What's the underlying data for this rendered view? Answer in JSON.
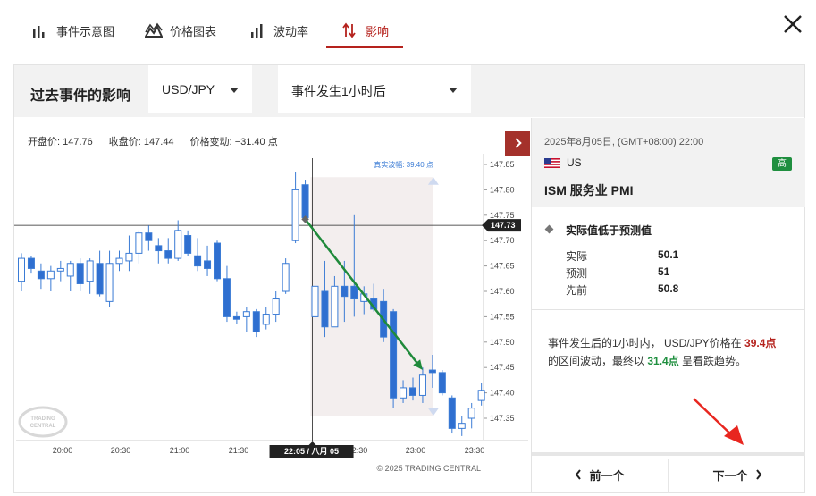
{
  "tabs": [
    {
      "label": "事件示意图",
      "icon": "bar-chart-icon"
    },
    {
      "label": "价格图表",
      "icon": "mountain-chart-icon"
    },
    {
      "label": "波动率",
      "icon": "volatility-bars-icon"
    },
    {
      "label": "影响",
      "icon": "up-down-arrows-icon",
      "active": true
    }
  ],
  "toolbar": {
    "title": "过去事件的影响",
    "pair_select": "USD/JPY",
    "time_select": "事件发生1小时后"
  },
  "stats": {
    "open_label": "开盘价:",
    "open": "147.76",
    "close_label": "收盘价:",
    "close": "147.44",
    "change_label": "价格变动:",
    "change": "−31.40 点"
  },
  "chart_data": {
    "type": "candlestick",
    "x_ticks": [
      "20:00",
      "20:30",
      "21:00",
      "21:30",
      "22:30",
      "23:00",
      "23:30"
    ],
    "crosshair_x_label": "22:05 / 八月 05",
    "y_ticks": [
      "147.85",
      "147.80",
      "147.75",
      "147.70",
      "147.65",
      "147.60",
      "147.55",
      "147.50",
      "147.45",
      "147.40",
      "147.35"
    ],
    "crosshair_y_label": "147.73",
    "ylim": [
      147.315,
      147.875
    ],
    "true_range_label": "真实波幅: 39.40 点",
    "copyright": "© 2025 TRADING CENTRAL",
    "watermark": "TRADING CENTRAL",
    "candles": [
      {
        "o": 147.62,
        "h": 147.675,
        "l": 147.6,
        "c": 147.665
      },
      {
        "o": 147.665,
        "h": 147.67,
        "l": 147.635,
        "c": 147.645
      },
      {
        "o": 147.64,
        "h": 147.655,
        "l": 147.605,
        "c": 147.625
      },
      {
        "o": 147.625,
        "h": 147.65,
        "l": 147.6,
        "c": 147.64
      },
      {
        "o": 147.64,
        "h": 147.66,
        "l": 147.62,
        "c": 147.645
      },
      {
        "o": 147.63,
        "h": 147.66,
        "l": 147.6,
        "c": 147.655
      },
      {
        "o": 147.655,
        "h": 147.665,
        "l": 147.6,
        "c": 147.615
      },
      {
        "o": 147.62,
        "h": 147.665,
        "l": 147.595,
        "c": 147.66
      },
      {
        "o": 147.655,
        "h": 147.68,
        "l": 147.59,
        "c": 147.595
      },
      {
        "o": 147.58,
        "h": 147.68,
        "l": 147.57,
        "c": 147.655
      },
      {
        "o": 147.655,
        "h": 147.68,
        "l": 147.64,
        "c": 147.665
      },
      {
        "o": 147.66,
        "h": 147.71,
        "l": 147.64,
        "c": 147.675
      },
      {
        "o": 147.675,
        "h": 147.72,
        "l": 147.655,
        "c": 147.715
      },
      {
        "o": 147.715,
        "h": 147.73,
        "l": 147.68,
        "c": 147.7
      },
      {
        "o": 147.69,
        "h": 147.705,
        "l": 147.655,
        "c": 147.68
      },
      {
        "o": 147.68,
        "h": 147.705,
        "l": 147.655,
        "c": 147.665
      },
      {
        "o": 147.665,
        "h": 147.74,
        "l": 147.66,
        "c": 147.72
      },
      {
        "o": 147.71,
        "h": 147.72,
        "l": 147.67,
        "c": 147.675
      },
      {
        "o": 147.67,
        "h": 147.705,
        "l": 147.64,
        "c": 147.65
      },
      {
        "o": 147.66,
        "h": 147.69,
        "l": 147.63,
        "c": 147.645
      },
      {
        "o": 147.695,
        "h": 147.7,
        "l": 147.62,
        "c": 147.625
      },
      {
        "o": 147.625,
        "h": 147.65,
        "l": 147.54,
        "c": 147.55
      },
      {
        "o": 147.55,
        "h": 147.56,
        "l": 147.535,
        "c": 147.545
      },
      {
        "o": 147.55,
        "h": 147.57,
        "l": 147.52,
        "c": 147.56
      },
      {
        "o": 147.56,
        "h": 147.565,
        "l": 147.51,
        "c": 147.52
      },
      {
        "o": 147.535,
        "h": 147.57,
        "l": 147.525,
        "c": 147.555
      },
      {
        "o": 147.555,
        "h": 147.6,
        "l": 147.54,
        "c": 147.585
      },
      {
        "o": 147.6,
        "h": 147.665,
        "l": 147.595,
        "c": 147.655
      },
      {
        "o": 147.7,
        "h": 147.835,
        "l": 147.695,
        "c": 147.8
      },
      {
        "o": 147.81,
        "h": 147.82,
        "l": 147.735,
        "c": 147.745
      },
      {
        "o": 147.55,
        "h": 147.74,
        "l": 147.55,
        "c": 147.61
      },
      {
        "o": 147.6,
        "h": 147.66,
        "l": 147.51,
        "c": 147.53
      },
      {
        "o": 147.53,
        "h": 147.63,
        "l": 147.53,
        "c": 147.61
      },
      {
        "o": 147.61,
        "h": 147.66,
        "l": 147.54,
        "c": 147.59
      },
      {
        "o": 147.61,
        "h": 147.75,
        "l": 147.55,
        "c": 147.585
      },
      {
        "o": 147.58,
        "h": 147.61,
        "l": 147.555,
        "c": 147.595
      },
      {
        "o": 147.585,
        "h": 147.615,
        "l": 147.56,
        "c": 147.565
      },
      {
        "o": 147.58,
        "h": 147.605,
        "l": 147.5,
        "c": 147.51
      },
      {
        "o": 147.56,
        "h": 147.565,
        "l": 147.37,
        "c": 147.39
      },
      {
        "o": 147.39,
        "h": 147.425,
        "l": 147.38,
        "c": 147.41
      },
      {
        "o": 147.41,
        "h": 147.43,
        "l": 147.385,
        "c": 147.395
      },
      {
        "o": 147.395,
        "h": 147.45,
        "l": 147.38,
        "c": 147.435
      },
      {
        "o": 147.445,
        "h": 147.475,
        "l": 147.41,
        "c": 147.44
      },
      {
        "o": 147.44,
        "h": 147.445,
        "l": 147.395,
        "c": 147.4
      },
      {
        "o": 147.39,
        "h": 147.395,
        "l": 147.32,
        "c": 147.33
      },
      {
        "o": 147.33,
        "h": 147.355,
        "l": 147.315,
        "c": 147.34
      },
      {
        "o": 147.35,
        "h": 147.38,
        "l": 147.33,
        "c": 147.37
      },
      {
        "o": 147.385,
        "h": 147.42,
        "l": 147.375,
        "c": 147.405
      }
    ],
    "event_index": 29,
    "trend_start": 147.742,
    "trend_end": 147.445,
    "trend_end_index": 41
  },
  "event": {
    "datetime": "2025年8月05日, (GMT+08:00) 22:00",
    "country": "US",
    "impact": "高",
    "name": "ISM 服务业 PMI",
    "result_title": "实际值低于预测值",
    "rows": [
      {
        "label": "实际",
        "value": "50.1"
      },
      {
        "label": "预测",
        "value": "51"
      },
      {
        "label": "先前",
        "value": "50.8"
      }
    ]
  },
  "summary": {
    "p1": "事件发生后的1小时内， USD/JPY价格在 ",
    "range": "39.4点",
    "p2": "的区间波动，最终以 ",
    "move": "31.4点",
    "p3": " 呈看跌趋势。"
  },
  "nav": {
    "prev": "前一个",
    "next": "下一个"
  },
  "colors": {
    "accent": "#b5221d",
    "bull": "#3a7bd5",
    "bear": "#2f6fd0",
    "trend": "#1f8a3b",
    "impact_high": "#1f8f3f"
  }
}
